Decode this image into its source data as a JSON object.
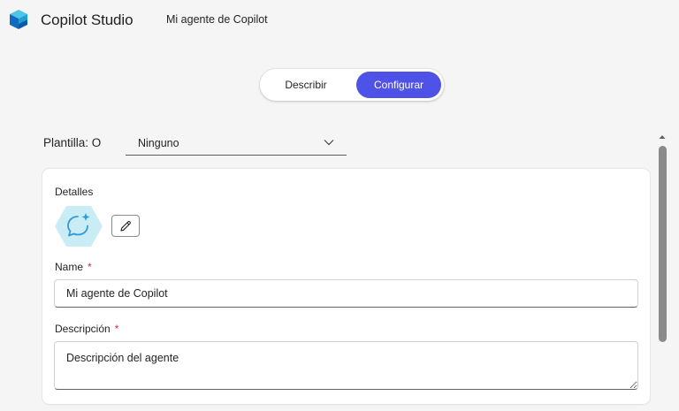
{
  "header": {
    "app_title": "Copilot Studio",
    "agent_title": "Mi agente de Copilot",
    "logo_icon": "copilot-studio-logo"
  },
  "mode_toggle": {
    "options": [
      "Describir",
      "Configurar"
    ],
    "selected": "Configurar",
    "accent_color": "#4f52e6"
  },
  "template": {
    "label": "Plantilla: O",
    "selected": "Ninguno",
    "icon": "chevron-down-icon"
  },
  "details": {
    "title": "Detalles",
    "avatar_icon": "chat-sparkle-icon",
    "edit_icon": "pencil-icon",
    "name_label": "Name",
    "name_required_mark": "*",
    "name_value": "Mi agente de Copilot",
    "description_label": "Descripción",
    "description_required_mark": "*",
    "description_value": "Descripción del agente"
  },
  "colors": {
    "required": "#c4314b",
    "avatar_bg": "#c9ecf5",
    "avatar_icon": "#2f9bd6"
  }
}
